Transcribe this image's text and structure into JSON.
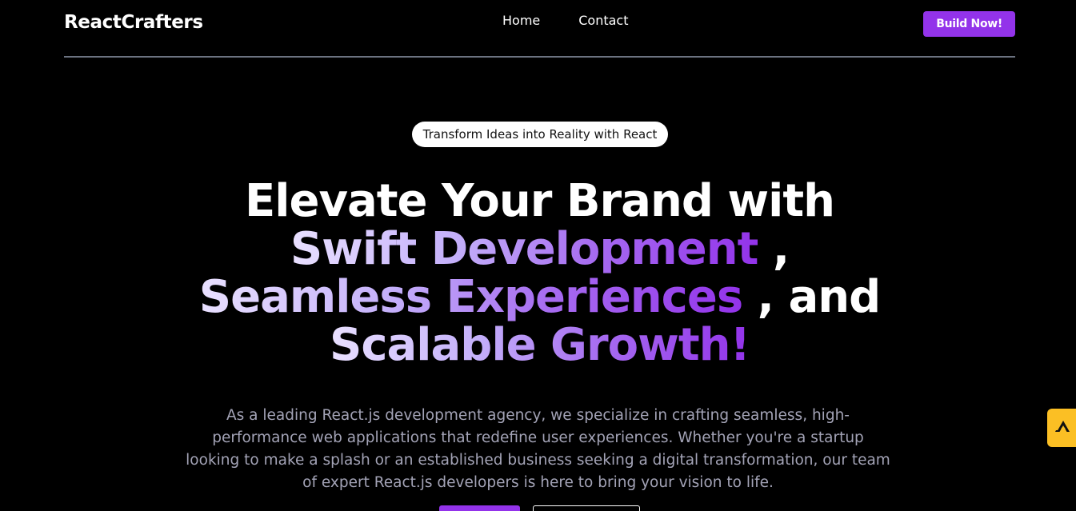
{
  "header": {
    "brand": "ReactCrafters",
    "nav": [
      {
        "label": "Home"
      },
      {
        "label": "Contact"
      }
    ],
    "cta_label": "Build Now!"
  },
  "hero": {
    "badge": "Transform Ideas into Reality with React",
    "headline": {
      "line1": "Elevate Your Brand with",
      "line2_highlight": "Swift Development",
      "line2_suffix": " ,",
      "line3_highlight": "Seamless Experiences",
      "line3_suffix": " , and",
      "line4_highlight": "Scalable Growth!"
    },
    "description": "As a leading React.js development agency, we specialize in crafting seamless, high-performance web applications that redefine user experiences. Whether you're a startup looking to make a splash or an established business seeking a digital transformation, our team of expert React.js developers is here to bring your vision to life."
  },
  "colors": {
    "background": "#000000",
    "accent": "#9333ea",
    "divider": "#6b7280",
    "widget": "#fbbf24"
  },
  "icons": {
    "floating_widget": "triangle-logo-icon"
  }
}
